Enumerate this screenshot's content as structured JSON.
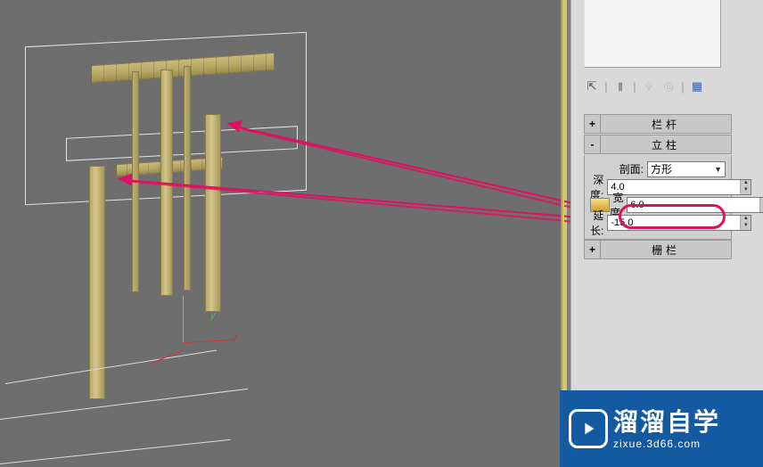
{
  "rollouts": {
    "railing": {
      "toggle": "+",
      "title": "栏杆"
    },
    "post": {
      "toggle": "-",
      "title": "立柱"
    },
    "fence": {
      "toggle": "+",
      "title": "栅栏"
    }
  },
  "post_params": {
    "profile_label": "剖面:",
    "profile_value": "方形",
    "depth_label": "深度:",
    "depth_value": "4.0",
    "width_label": "宽度:",
    "width_value": "6.0",
    "extend_label": "延长:",
    "extend_value": "-15.0"
  },
  "axis": {
    "x": "x",
    "y": "y"
  },
  "watermark": {
    "title": "溜溜自学",
    "sub": "zixue.3d66.com"
  },
  "tool_icons": {
    "pin": "⇱",
    "pause": "‖",
    "sep": "|",
    "key": "⩒",
    "circle": "◎",
    "grid": "▦"
  }
}
